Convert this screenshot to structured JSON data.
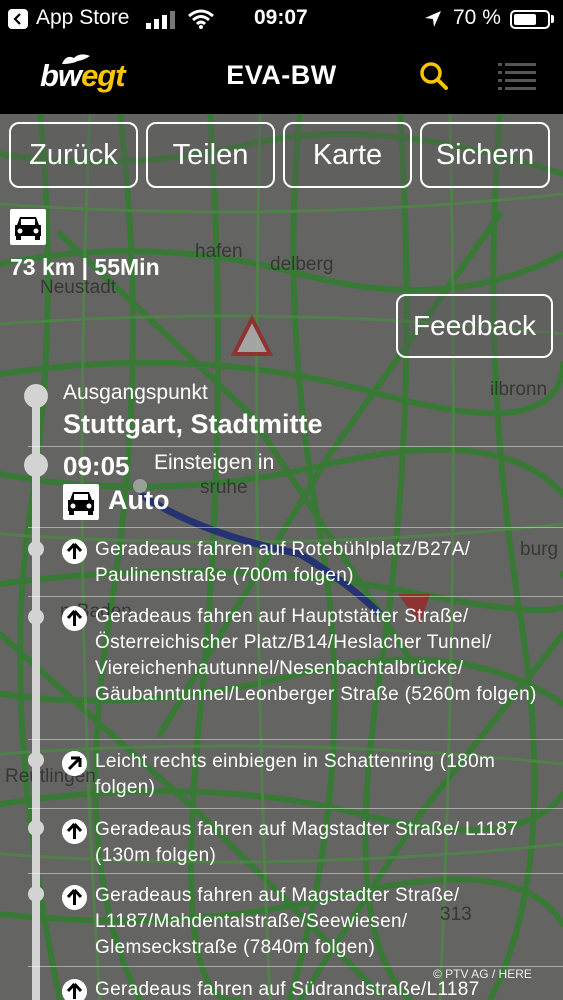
{
  "status_bar": {
    "back_app": "App Store",
    "time": "09:07",
    "battery_text": "70 %",
    "battery_level": 0.7
  },
  "header": {
    "logo_part1": "bw",
    "logo_part2": "egt",
    "title": "EVA-BW",
    "accent_color": "#f7c600"
  },
  "toolbar": {
    "back_label": "Zurück",
    "share_label": "Teilen",
    "map_label": "Karte",
    "save_label": "Sichern"
  },
  "summary": {
    "mode_icon": "car-icon",
    "distance_duration": "73 km | 55Min"
  },
  "feedback_label": "Feedback",
  "map": {
    "labels": [
      "hafen",
      "delberg",
      "Neustadt",
      "ilbronn",
      "sruhe",
      "burg",
      "n-Baden",
      "Reutlingen",
      "313"
    ],
    "copyright": "© PTV AG / HERE"
  },
  "route": {
    "origin_label": "Ausgangspunkt",
    "origin_name": "Stuttgart, Stadtmitte",
    "departure_time": "09:05",
    "departure_text": "Einsteigen in",
    "mode": "Auto",
    "steps": [
      {
        "icon": "arrow-up-icon",
        "text": "Geradeaus fahren auf Rotebühlplatz/B27A/ Paulinenstraße (700m folgen)"
      },
      {
        "icon": "arrow-up-icon",
        "text": "Geradeaus fahren auf Hauptstätter Straße/ Österreichischer Platz/B14/Heslacher Tunnel/ Viereichenhautunnel/Nesenbachtalbrücke/ Gäubahntunnel/Leonberger Straße (5260m folgen)"
      },
      {
        "icon": "arrow-up-right-icon",
        "text": "Leicht rechts einbiegen in Schattenring (180m folgen)"
      },
      {
        "icon": "arrow-up-icon",
        "text": "Geradeaus fahren auf Magstadter Straße/ L1187 (130m folgen)"
      },
      {
        "icon": "arrow-up-icon",
        "text": "Geradeaus fahren auf Magstadter Straße/ L1187/Mahdentalstraße/Seewiesen/ Glemseckstraße (7840m folgen)"
      },
      {
        "icon": "arrow-up-icon",
        "text": "Geradeaus fahren auf Südrandstraße/L1187"
      }
    ]
  }
}
